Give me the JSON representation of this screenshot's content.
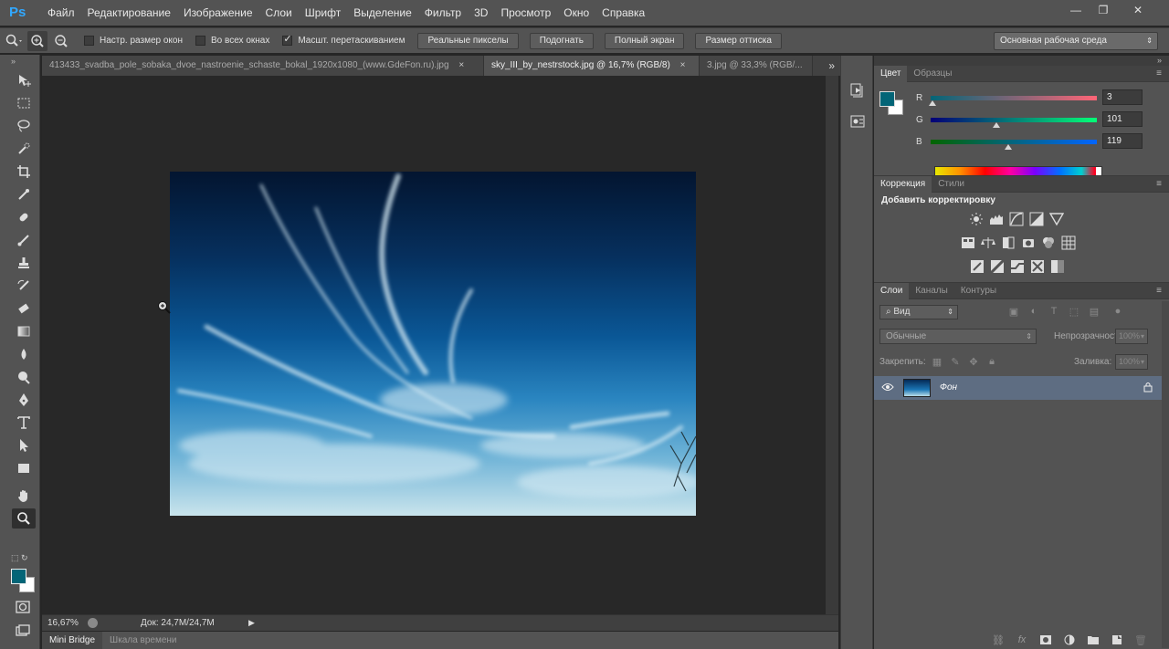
{
  "app": {
    "logo": "Ps",
    "menu": [
      "Файл",
      "Редактирование",
      "Изображение",
      "Слои",
      "Шрифт",
      "Выделение",
      "Фильтр",
      "3D",
      "Просмотр",
      "Окно",
      "Справка"
    ],
    "window_buttons": [
      "minimize-icon",
      "restore-icon",
      "close-icon"
    ]
  },
  "options_bar": {
    "checkboxes": [
      {
        "label": "Настр. размер окон",
        "checked": false
      },
      {
        "label": "Во всех окнах",
        "checked": false
      },
      {
        "label": "Масшт. перетаскиванием",
        "checked": true
      }
    ],
    "buttons": [
      "Реальные пикселы",
      "Подогнать",
      "Полный экран",
      "Размер оттиска"
    ],
    "workspace": "Основная рабочая среда"
  },
  "tabs": [
    {
      "title": "413433_svadba_pole_sobaka_dvoe_nastroenie_schaste_bokal_1920x1080_(www.GdeFon.ru).jpg",
      "active": false
    },
    {
      "title": "sky_III_by_nestrstock.jpg @ 16,7% (RGB/8)",
      "active": true
    },
    {
      "title": "3.jpg @ 33,3% (RGB/...",
      "active": false
    }
  ],
  "tabs_more": "»",
  "tools": [
    "move-tool",
    "marquee-tool",
    "lasso-tool",
    "quick-select-tool",
    "crop-tool",
    "eyedropper-tool",
    "healing-brush-tool",
    "brush-tool",
    "stamp-tool",
    "history-brush-tool",
    "eraser-tool",
    "gradient-tool",
    "blur-tool",
    "dodge-tool",
    "pen-tool",
    "type-tool",
    "path-select-tool",
    "shape-tool",
    "hand-tool",
    "zoom-tool"
  ],
  "colors": {
    "foreground": "#036577",
    "background": "#ffffff",
    "accent": "#31a8ff"
  },
  "status": {
    "zoom": "16,67%",
    "doc": "Док: 24,7M/24,7M"
  },
  "bottom_tabs": [
    "Mini Bridge",
    "Шкала времени"
  ],
  "color_panel": {
    "tabs": [
      "Цвет",
      "Образцы"
    ],
    "channels": [
      {
        "label": "R",
        "value": "3",
        "fraction": 0.012
      },
      {
        "label": "G",
        "value": "101",
        "fraction": 0.396
      },
      {
        "label": "B",
        "value": "119",
        "fraction": 0.467
      }
    ]
  },
  "adjustments_panel": {
    "tabs": [
      "Коррекция",
      "Стили"
    ],
    "title": "Добавить корректировку"
  },
  "layers_panel": {
    "tabs": [
      "Слои",
      "Каналы",
      "Контуры"
    ],
    "filter": "Вид",
    "blend_mode": "Обычные",
    "opacity_label": "Непрозрачность:",
    "opacity": "100%",
    "lock_label": "Закрепить:",
    "fill_label": "Заливка:",
    "fill": "100%",
    "layers": [
      {
        "name": "Фон",
        "visible": true,
        "locked": true
      }
    ]
  }
}
